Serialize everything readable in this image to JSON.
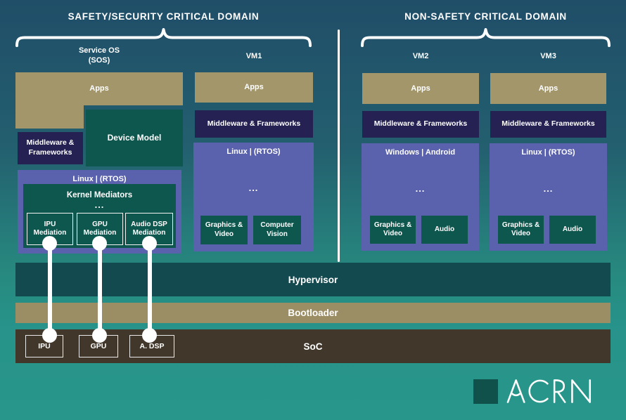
{
  "palette": {
    "bg_top": "#204e68",
    "bg_bottom": "#28968b",
    "apps_khaki": "#a3966b",
    "middleware_navy": "#252253",
    "os_purple": "#5a61ad",
    "block_teal": "#0e574e",
    "hypervisor_teal": "#134a50",
    "bootloader_khaki": "#9c8e64",
    "soc_brown": "#41372a",
    "logo_square_teal": "#11514b",
    "line_white": "#ffffff"
  },
  "domains": {
    "left": {
      "title": "SAFETY/SECURITY CRITICAL DOMAIN"
    },
    "right": {
      "title": "NON-SAFETY CRITICAL DOMAIN"
    }
  },
  "sos": {
    "label_line1": "Service OS",
    "label_line2": "(SOS)",
    "apps": "Apps",
    "device_model": "Device Model",
    "middleware": "Middleware & Frameworks",
    "os": "Linux | (RTOS)",
    "kernel_title": "Kernel Mediators",
    "ellipsis": "...",
    "mediators": [
      {
        "label": "IPU Mediation"
      },
      {
        "label": "GPU Mediation"
      },
      {
        "label": "Audio DSP Mediation"
      }
    ]
  },
  "vms": [
    {
      "label": "VM1",
      "apps": "Apps",
      "middleware": "Middleware & Frameworks",
      "os": "Linux | (RTOS)",
      "ellipsis": "...",
      "services": [
        {
          "label": "Graphics & Video"
        },
        {
          "label": "Computer Vision"
        }
      ]
    },
    {
      "label": "VM2",
      "apps": "Apps",
      "middleware": "Middleware & Frameworks",
      "os": "Windows | Android",
      "ellipsis": "...",
      "services": [
        {
          "label": "Graphics & Video"
        },
        {
          "label": "Audio"
        }
      ]
    },
    {
      "label": "VM3",
      "apps": "Apps",
      "middleware": "Middleware & Frameworks",
      "os": "Linux | (RTOS)",
      "ellipsis": "...",
      "services": [
        {
          "label": "Graphics & Video"
        },
        {
          "label": "Audio"
        }
      ]
    }
  ],
  "layers": {
    "hypervisor": "Hypervisor",
    "bootloader": "Bootloader",
    "soc": "SoC"
  },
  "soc_components": [
    {
      "label": "IPU"
    },
    {
      "label": "GPU"
    },
    {
      "label": "A. DSP"
    }
  ],
  "logo": {
    "text": "ACRN"
  }
}
